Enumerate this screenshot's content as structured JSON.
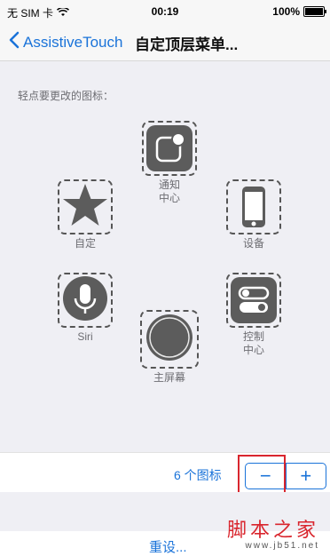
{
  "status_bar": {
    "carrier": "无 SIM 卡",
    "time": "00:19",
    "battery": "100%"
  },
  "nav": {
    "back_label": "AssistiveTouch",
    "title": "自定顶层菜单..."
  },
  "content": {
    "instruction": "轻点要更改的图标：",
    "icons": [
      {
        "name": "notification-center",
        "label_line1": "通知",
        "label_line2": "中心",
        "icon": "notification-icon"
      },
      {
        "name": "custom",
        "label_line1": "自定",
        "label_line2": "",
        "icon": "star-icon"
      },
      {
        "name": "device",
        "label_line1": "设备",
        "label_line2": "",
        "icon": "phone-icon"
      },
      {
        "name": "siri",
        "label_line1": "Siri",
        "label_line2": "",
        "icon": "microphone-icon"
      },
      {
        "name": "control-center",
        "label_line1": "控制",
        "label_line2": "中心",
        "icon": "toggles-icon"
      },
      {
        "name": "home",
        "label_line1": "主屏幕",
        "label_line2": "",
        "icon": "home-circle-icon"
      }
    ]
  },
  "bottom": {
    "count_label": "6 个图标",
    "minus": "−",
    "plus": "+",
    "reset": "重设..."
  },
  "watermark": {
    "text": "脚本之家",
    "url": "www.jb51.net"
  },
  "colors": {
    "accent": "#1a73d9",
    "highlight": "#d9262e",
    "icon_gray": "#5c5c5c",
    "background": "#efeff4"
  }
}
